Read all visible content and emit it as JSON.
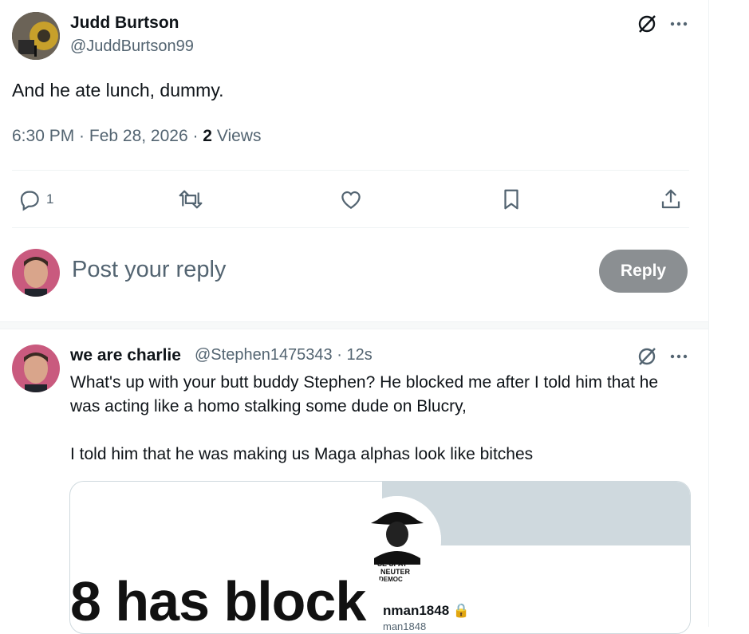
{
  "main_tweet": {
    "author_name": "Judd Burtson",
    "author_handle": "@JuddBurtson99",
    "text": "And he ate lunch, dummy.",
    "time": "6:30 PM · Feb 28, 2026 · ",
    "views_count": "2",
    "views_label": "Views",
    "reply_count": "1"
  },
  "compose": {
    "placeholder": "Post your reply",
    "reply_button": "Reply"
  },
  "reply_tweet": {
    "author_name": "we are charlie",
    "author_handle": "@Stephen1475343",
    "time": " · 12s",
    "text_line1": "What's up with your butt buddy Stephen?  He blocked me after I told him that he was acting like a homo stalking some dude on Blucry,",
    "text_line2": "I told him that he was making us Maga alphas look like bitches",
    "media": {
      "text": "8 has block",
      "profile_name": "nman1848",
      "profile_handle": "man1848",
      "shirt_text": "SE SPAY NEUTER DEMOC"
    }
  },
  "colors": {
    "secondary_text": "#536471",
    "reply_button_bg": "#8b8f92",
    "divider": "#eff3f4"
  }
}
